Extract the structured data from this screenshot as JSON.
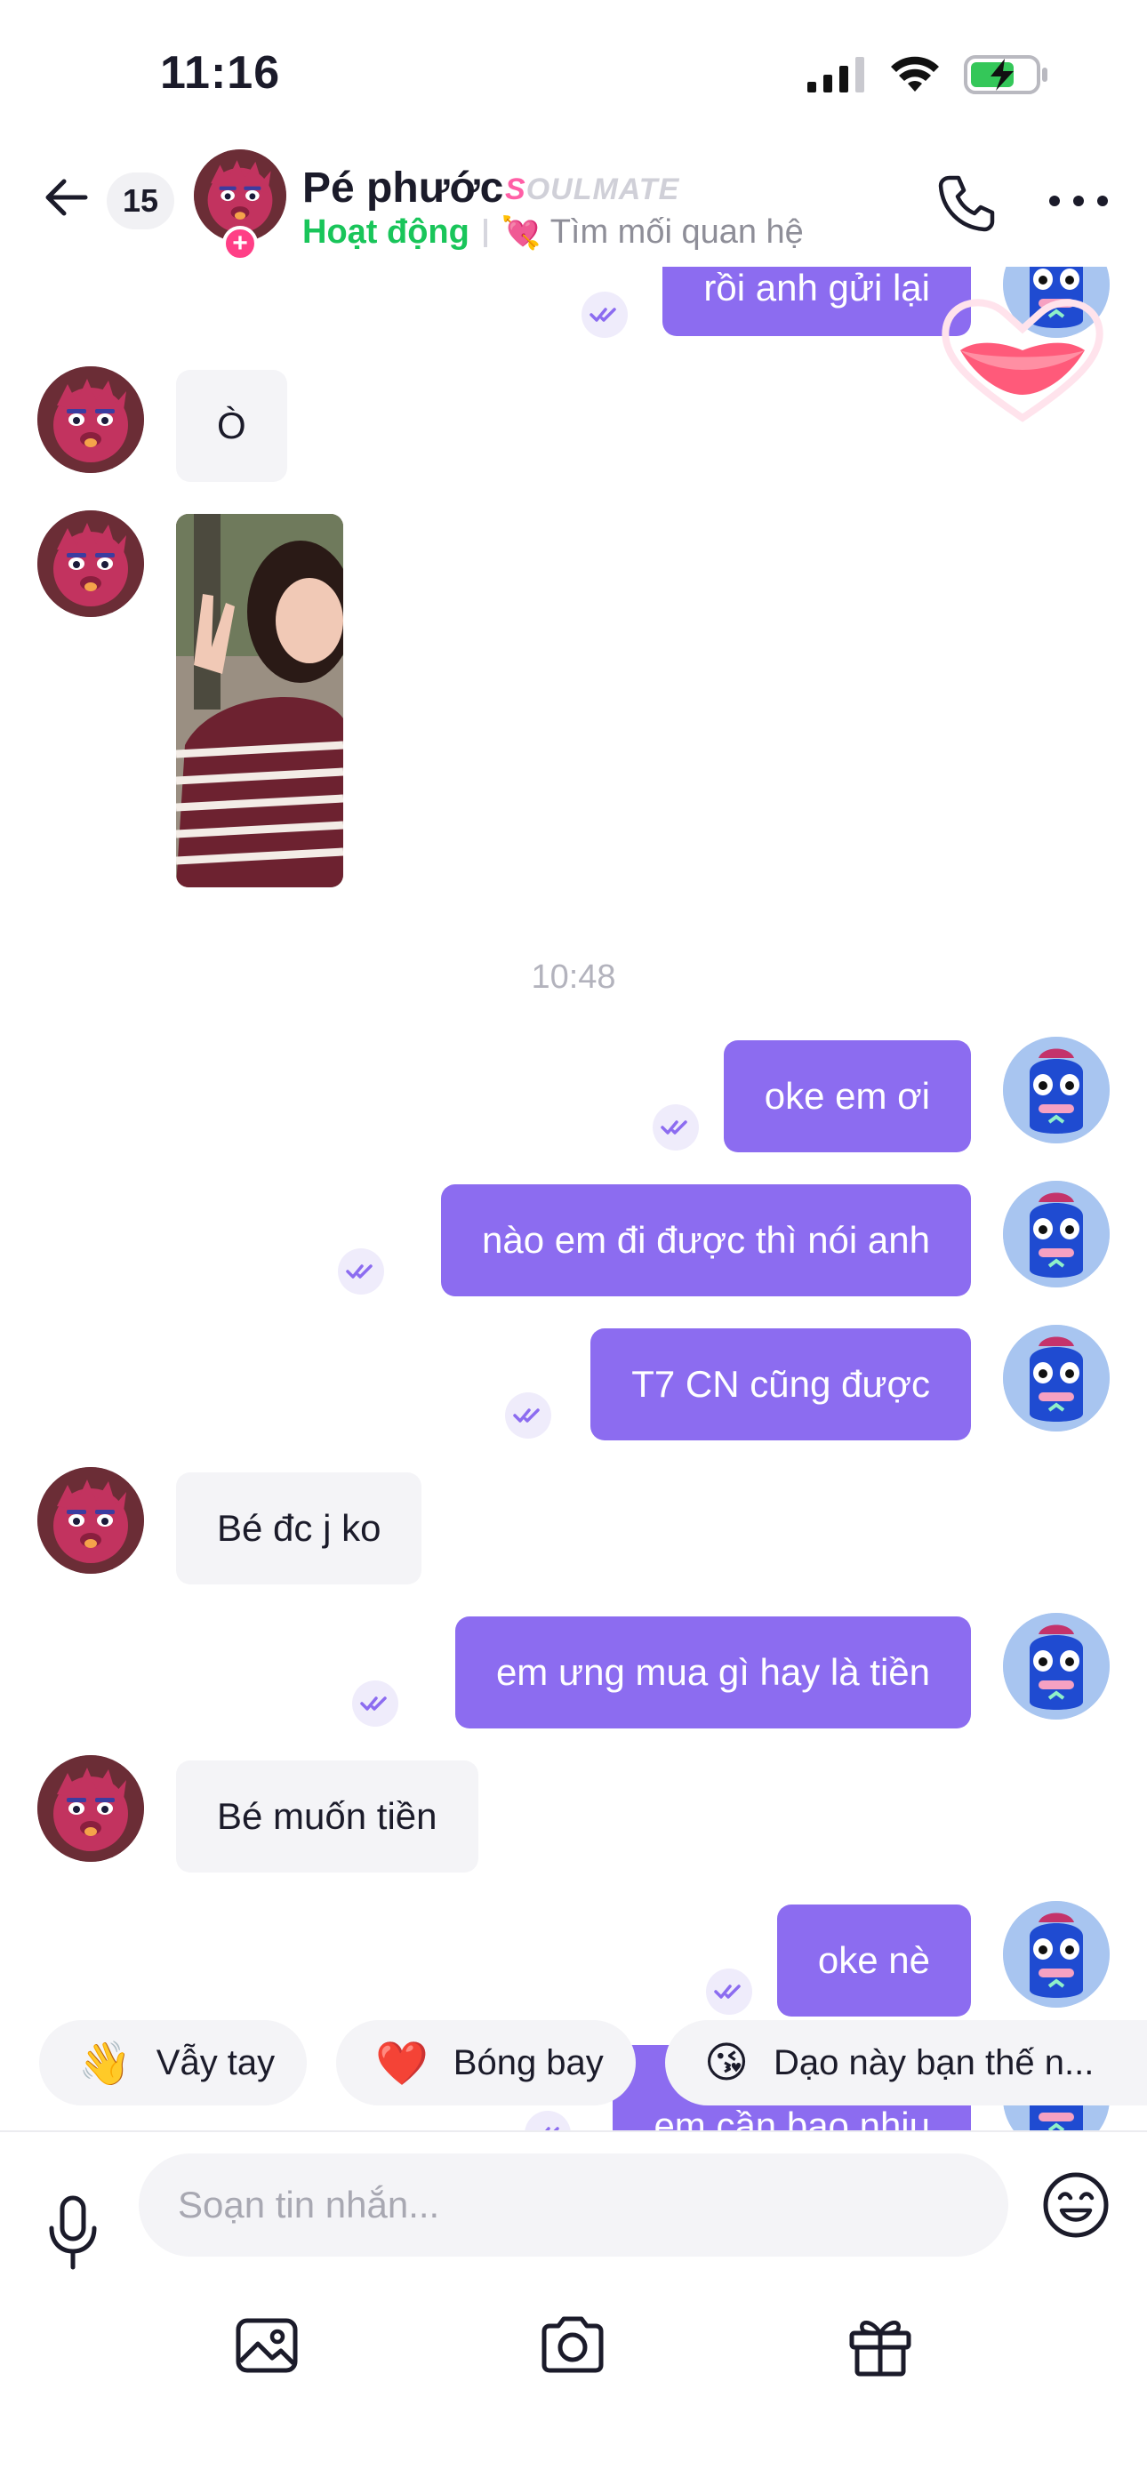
{
  "status_bar": {
    "time": "11:16"
  },
  "header": {
    "unread_count": "15",
    "contact_name": "Pé phước",
    "soulmate_first": "S",
    "soulmate_rest": "OULMATE",
    "presence": "Hoạt động",
    "seeking_emoji": "💘",
    "seeking_text": "Tìm mối quan hệ"
  },
  "messages": {
    "m0": "rồi anh gửi lại",
    "m1": "Ò",
    "time_divider": "10:48",
    "m2": "oke em ơi",
    "m3": "nào em đi được thì nói anh",
    "m4": "T7 CN cũng được",
    "m5": "Bé đc j ko",
    "m6": "em ưng mua gì hay là tiền",
    "m7": "Bé muốn tiền",
    "m8": "oke nè",
    "m9": "em cần bao nhiu"
  },
  "quick_reactions": [
    {
      "emoji": "👋",
      "label": "Vẫy tay"
    },
    {
      "emoji": "❤️",
      "label": "Bóng bay"
    },
    {
      "emoji": "😘",
      "label": "Dạo này bạn thế n..."
    }
  ],
  "composer": {
    "placeholder": "Soạn tin nhắn..."
  },
  "colors": {
    "accent": "#8c6cf0",
    "online": "#19c55a",
    "incoming_bubble": "#f4f4f7"
  }
}
